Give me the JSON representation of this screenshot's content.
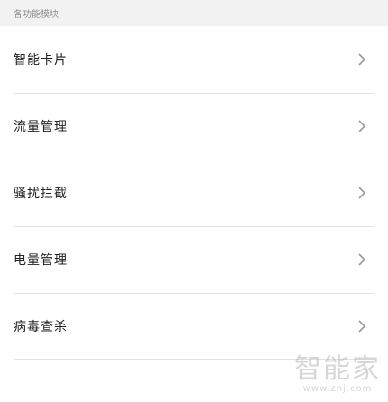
{
  "section": {
    "title": "各功能模块"
  },
  "items": [
    {
      "label": "智能卡片"
    },
    {
      "label": "流量管理"
    },
    {
      "label": "骚扰拦截"
    },
    {
      "label": "电量管理"
    },
    {
      "label": "病毒查杀"
    }
  ],
  "icons": {
    "row_arrow": "chevron-right-icon"
  },
  "watermark": {
    "text": "智能家",
    "url": "www.znj.com"
  },
  "colors": {
    "header_bg": "#f2f2f2",
    "divider": "#e3e3e3",
    "chevron": "#999999"
  }
}
